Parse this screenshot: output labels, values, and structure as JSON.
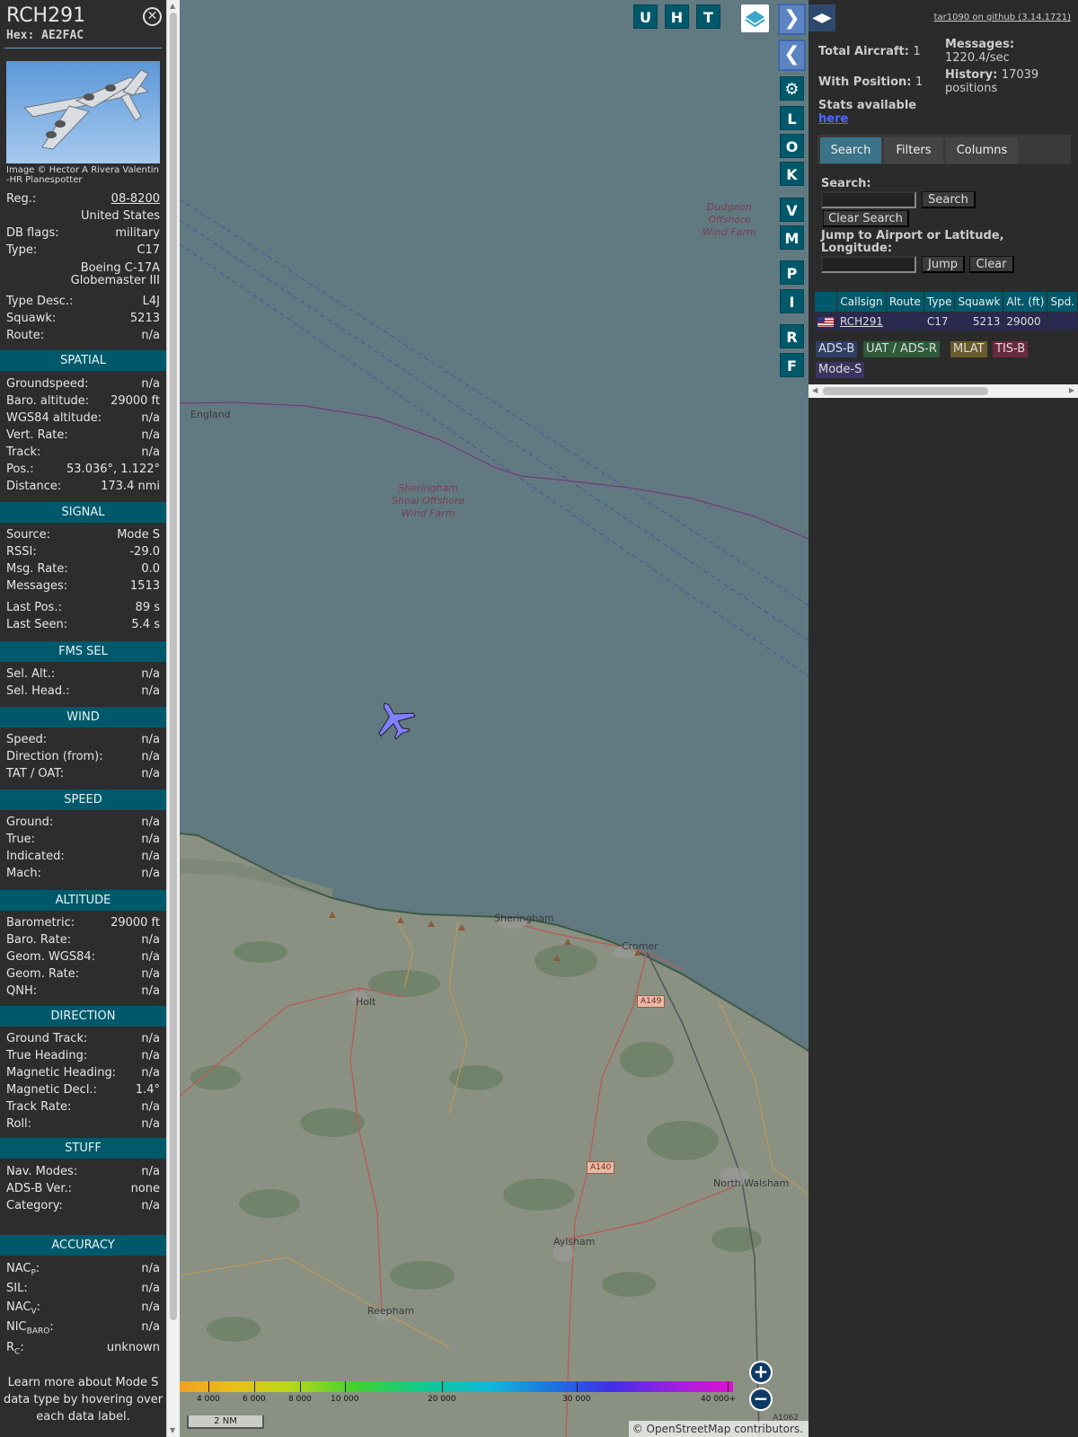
{
  "info": {
    "callsign": "RCH291",
    "hex": "Hex: AE2FAC",
    "photo_credit": "Image © Hector A Rivera Valentin -HR Planespotter",
    "top_rows": [
      {
        "label": "Reg.:",
        "value": "08-8200"
      },
      {
        "label": "",
        "value": "United States"
      },
      {
        "label": "DB flags:",
        "value": "military"
      },
      {
        "label": "Type:",
        "value": "C17"
      }
    ],
    "type_long_1": "Boeing C-17A",
    "type_long_2": "Globemaster III",
    "rows2": [
      {
        "label": "Type Desc.:",
        "value": "L4J"
      },
      {
        "label": "Squawk:",
        "value": "5213"
      },
      {
        "label": "Route:",
        "value": "n/a"
      }
    ],
    "sections": {
      "spatial": "SPATIAL",
      "signal": "SIGNAL",
      "fms": "FMS SEL",
      "wind": "WIND",
      "speed": "SPEED",
      "altitude": "ALTITUDE",
      "direction": "DIRECTION",
      "stuff": "STUFF",
      "accuracy": "ACCURACY"
    },
    "spatial": [
      {
        "label": "Groundspeed:",
        "value": "n/a"
      },
      {
        "label": "Baro. altitude:",
        "value": "29000 ft"
      },
      {
        "label": "WGS84 altitude:",
        "value": "n/a"
      },
      {
        "label": "Vert. Rate:",
        "value": "n/a"
      },
      {
        "label": "Track:",
        "value": "n/a"
      },
      {
        "label": "Pos.:",
        "value": "53.036°, 1.122°"
      },
      {
        "label": "Distance:",
        "value": "173.4 nmi"
      }
    ],
    "signal": [
      {
        "label": "Source:",
        "value": "Mode S"
      },
      {
        "label": "RSSI:",
        "value": "-29.0"
      },
      {
        "label": "Msg. Rate:",
        "value": "0.0"
      },
      {
        "label": "Messages:",
        "value": "1513"
      },
      {
        "label": "Last Pos.:",
        "value": "89 s"
      },
      {
        "label": "Last Seen:",
        "value": "5.4 s"
      }
    ],
    "fms": [
      {
        "label": "Sel. Alt.:",
        "value": "n/a"
      },
      {
        "label": "Sel. Head.:",
        "value": "n/a"
      }
    ],
    "wind": [
      {
        "label": "Speed:",
        "value": "n/a"
      },
      {
        "label": "Direction (from):",
        "value": "n/a"
      },
      {
        "label": "TAT / OAT:",
        "value": "n/a"
      }
    ],
    "speed": [
      {
        "label": "Ground:",
        "value": "n/a"
      },
      {
        "label": "True:",
        "value": "n/a"
      },
      {
        "label": "Indicated:",
        "value": "n/a"
      },
      {
        "label": "Mach:",
        "value": "n/a"
      }
    ],
    "altitude": [
      {
        "label": "Barometric:",
        "value": "29000 ft"
      },
      {
        "label": "Baro. Rate:",
        "value": "n/a"
      },
      {
        "label": "Geom. WGS84:",
        "value": "n/a"
      },
      {
        "label": "Geom. Rate:",
        "value": "n/a"
      },
      {
        "label": "QNH:",
        "value": "n/a"
      }
    ],
    "direction": [
      {
        "label": "Ground Track:",
        "value": "n/a"
      },
      {
        "label": "True Heading:",
        "value": "n/a"
      },
      {
        "label": "Magnetic Heading:",
        "value": "n/a"
      },
      {
        "label": "Magnetic Decl.:",
        "value": "1.4°"
      },
      {
        "label": "Track Rate:",
        "value": "n/a"
      },
      {
        "label": "Roll:",
        "value": "n/a"
      }
    ],
    "stuff": [
      {
        "label": "Nav. Modes:",
        "value": "n/a"
      },
      {
        "label": "ADS-B Ver.:",
        "value": "none"
      },
      {
        "label": "Category:",
        "value": "n/a"
      }
    ],
    "accuracy": [
      {
        "label": "NAC",
        "sub": "P",
        "value": "n/a"
      },
      {
        "label": "SIL:",
        "sub": "",
        "value": "n/a"
      },
      {
        "label": "NAC",
        "sub": "V",
        "value": "n/a"
      },
      {
        "label": "NIC",
        "sub": "BARO",
        "value": "n/a"
      },
      {
        "label": "R",
        "sub": "C",
        "value": "unknown"
      }
    ],
    "learn_more": "Learn more about Mode S data type by hovering over each data label."
  },
  "map": {
    "top_buttons": [
      "U",
      "H",
      "T"
    ],
    "side_buttons": [
      "L",
      "O",
      "K",
      "V",
      "M",
      "P",
      "I",
      "R",
      "F"
    ],
    "place_labels": {
      "england": "England",
      "sheringham": "Sheringham",
      "cromer": "Cromer",
      "holt": "Holt",
      "north_walsham": "North Walsham",
      "aylsham": "Aylsham",
      "reepham": "Reepham"
    },
    "wind_farms": {
      "dudgeon": [
        "Dudgeon",
        "Offshore",
        "Wind Farm"
      ],
      "sheringham": [
        "Sheringham",
        "Shoal Offshore",
        "Wind Farm"
      ]
    },
    "roads": {
      "a149": "A149",
      "a140": "A140",
      "a1062": "A1062"
    },
    "altitude_scale": [
      "4 000",
      "6 000",
      "8 000",
      "10 000",
      "20 000",
      "30 000",
      "40 000+"
    ],
    "scale_bar": "2 NM",
    "attribution": "© OpenStreetMap contributors.",
    "aircraft_color": "#8080ff",
    "sea_color": "#617a81"
  },
  "side": {
    "github": "tar1090 on github (3.14.1721)",
    "total_aircraft_label": "Total Aircraft:",
    "total_aircraft": "1",
    "with_position_label": "With Position:",
    "with_position": "1",
    "stats_label": "Stats available",
    "stats_link": "here",
    "messages_label": "Messages:",
    "messages_value": "1220.4/sec",
    "history_label": "History:",
    "history_value": "17039",
    "history_unit": "positions",
    "tabs": [
      "Search",
      "Filters",
      "Columns"
    ],
    "search_label": "Search:",
    "search_button": "Search",
    "clear_search_button": "Clear Search",
    "jump_label_1": "Jump to Airport or Latitude,",
    "jump_label_2": "Longitude:",
    "jump_button": "Jump",
    "clear_button": "Clear",
    "table_headers": [
      "",
      "Callsign",
      "Route",
      "Type",
      "Squawk",
      "Alt. (ft)",
      "Spd."
    ],
    "table_row": {
      "callsign": "RCH291",
      "route": "",
      "type": "C17",
      "squawk": "5213",
      "alt": "29000",
      "spd": ""
    },
    "sources": [
      {
        "label": "ADS-B",
        "color": "#2f3f66"
      },
      {
        "label": "UAT / ADS-R",
        "color": "#2e5a3a"
      },
      {
        "label": "MLAT",
        "color": "#6b5a2a"
      },
      {
        "label": "TIS-B",
        "color": "#6a2a3e"
      },
      {
        "label": "Mode-S",
        "color": "#3a3460"
      }
    ]
  }
}
